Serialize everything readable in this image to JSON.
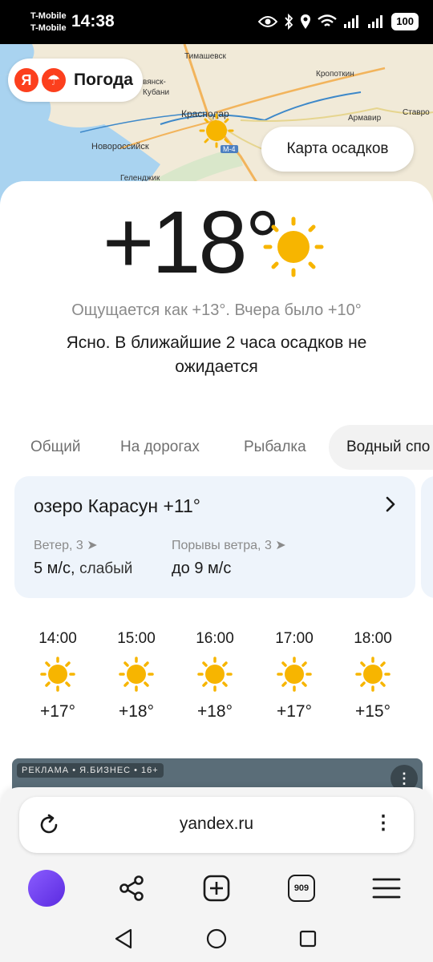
{
  "status_bar": {
    "carrier1": "T-Mobile",
    "carrier2": "T-Mobile",
    "time": "14:38",
    "battery": "100",
    "icons": [
      "eye-icon",
      "bluetooth-icon",
      "location-icon",
      "wifi-icon",
      "signal-icon",
      "signal-icon"
    ]
  },
  "map": {
    "labels": {
      "timashevsk": "Тимашевск",
      "kropotkin": "Кропоткин",
      "slavyansk": "вянск-",
      "kuban": "Кубани",
      "krasnodar": "Краснодар",
      "armavir": "Армавир",
      "stavropol": "Ставро",
      "novorossiysk": "Новороссийск",
      "gelendzhik": "Геленджик",
      "road": "М-4"
    },
    "logo_text": "Погода",
    "logo_ya": "Я",
    "precip_button": "Карта осадков"
  },
  "current": {
    "temperature": "+18°",
    "feels_like": "Ощущается как +13°. Вчера было +10°",
    "description": "Ясно. В ближайшие 2 часа осадков не ожидается",
    "icon": "sun-icon"
  },
  "tabs": [
    "Общий",
    "На дорогах",
    "Рыбалка",
    "Водный спо"
  ],
  "lake": {
    "title": "озеро Карасун +11°",
    "wind_label": "Ветер, 3 ➤",
    "wind_value": "5 м/с,",
    "wind_desc": "слабый",
    "gust_label": "Порывы ветра, 3 ➤",
    "gust_value": "до 9 м/с"
  },
  "hourly": [
    {
      "time": "14:00",
      "temp": "+17°"
    },
    {
      "time": "15:00",
      "temp": "+18°"
    },
    {
      "time": "16:00",
      "temp": "+18°"
    },
    {
      "time": "17:00",
      "temp": "+17°"
    },
    {
      "time": "18:00",
      "temp": "+15°"
    }
  ],
  "ad": {
    "badge": "РЕКЛАМА • Я.БИЗНЕС • 16+"
  },
  "browser": {
    "url": "yandex.ru",
    "tabs_count": "909"
  },
  "colors": {
    "sun": "#f7b500",
    "accent_red": "#fc3f1d",
    "card_bg": "#eef4fb"
  }
}
